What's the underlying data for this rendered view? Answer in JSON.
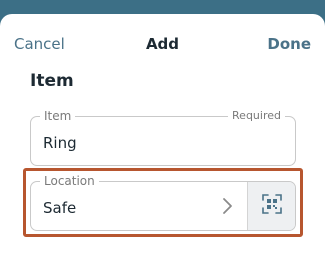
{
  "nav": {
    "cancel_label": "Cancel",
    "title": "Add",
    "done_label": "Done"
  },
  "section": {
    "title": "Item"
  },
  "fields": {
    "item": {
      "label": "Item",
      "required_label": "Required",
      "value": "Ring"
    },
    "location": {
      "label": "Location",
      "value": "Safe"
    }
  },
  "icons": {
    "chevron": "chevron-right-icon",
    "scan": "qr-scan-icon"
  },
  "colors": {
    "accent": "#4a7288",
    "highlight_border": "#b7562f"
  }
}
